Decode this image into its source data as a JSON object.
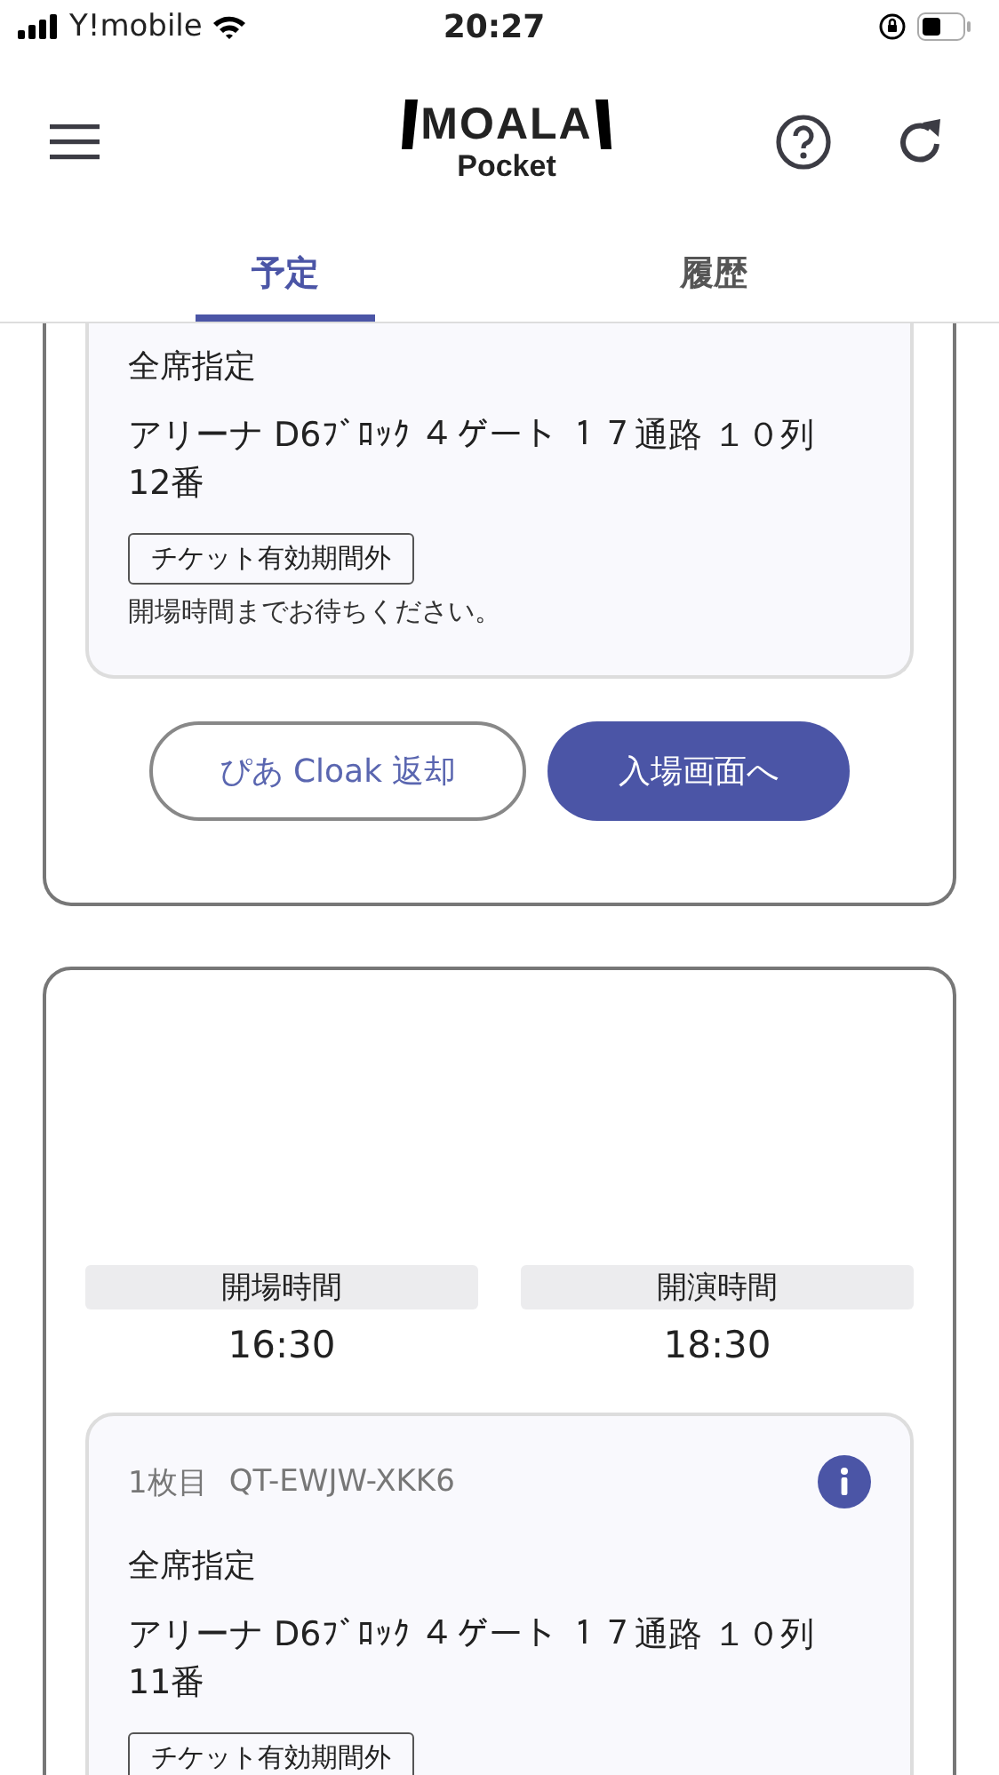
{
  "status_bar": {
    "carrier": "Y!mobile",
    "time": "20:27"
  },
  "header": {
    "logo_top": "MOALA",
    "logo_bottom": "Pocket"
  },
  "tabs": [
    {
      "label": "予定",
      "selected": true
    },
    {
      "label": "履歴",
      "selected": false
    }
  ],
  "cards": [
    {
      "tickets": [
        {
          "seat_type": "全席指定",
          "seat": "アリーナ D6ﾌﾞﾛｯｸ ４ゲート １７通路 １０列 12番",
          "status": "チケット有効期間外",
          "note": "開場時間までお待ちください。"
        }
      ],
      "buttons": [
        {
          "label": "ぴあ Cloak 返却",
          "kind": "outline"
        },
        {
          "label": "入場画面へ",
          "kind": "primary"
        }
      ]
    },
    {
      "times": [
        {
          "label": "開場時間",
          "value": "16:30"
        },
        {
          "label": "開演時間",
          "value": "18:30"
        }
      ],
      "tickets": [
        {
          "header": {
            "number": "1枚目",
            "code": "QT-EWJW-XKK6"
          },
          "seat_type": "全席指定",
          "seat": "アリーナ D6ﾌﾞﾛｯｸ ４ゲート １７通路 １０列 11番",
          "status": "チケット有効期間外"
        }
      ]
    }
  ]
}
